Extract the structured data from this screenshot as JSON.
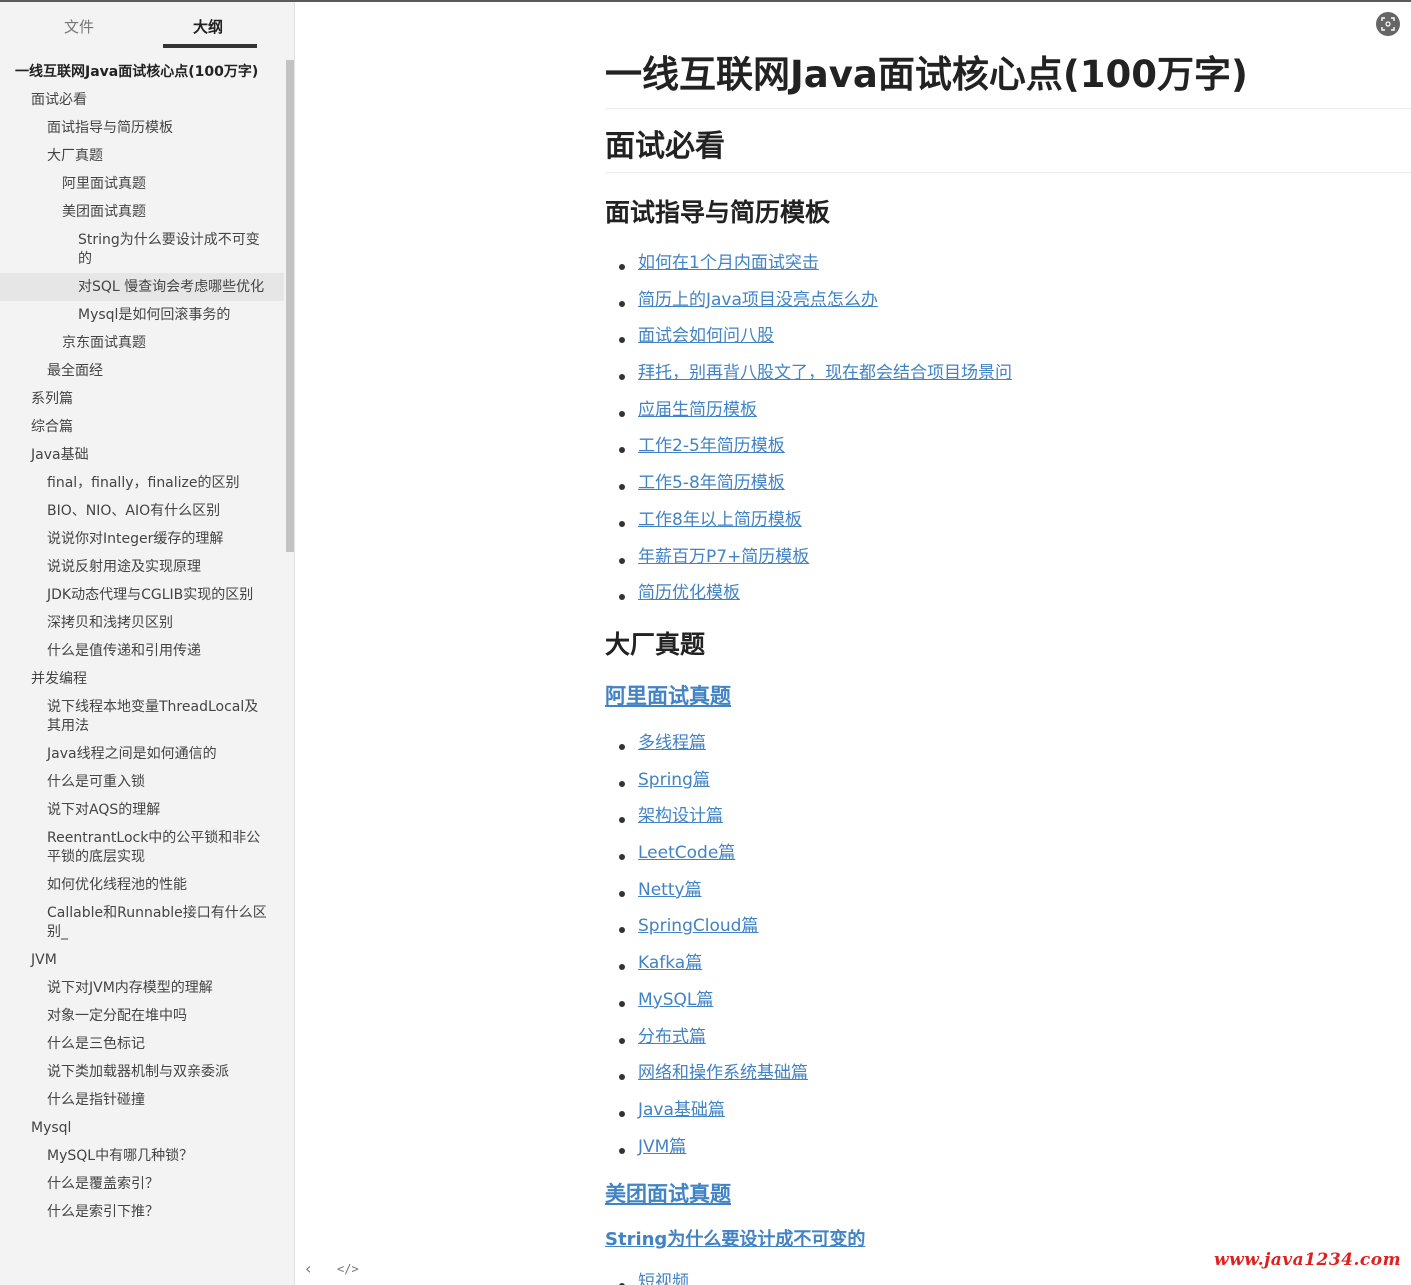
{
  "sidebar": {
    "tabs": {
      "files": "文件",
      "outline": "大纲"
    },
    "outline": [
      {
        "label": "一线互联网Java面试核心点(100万字)",
        "level": 0
      },
      {
        "label": "面试必看",
        "level": 1
      },
      {
        "label": "面试指导与简历模板",
        "level": 2
      },
      {
        "label": "大厂真题",
        "level": 2
      },
      {
        "label": "阿里面试真题",
        "level": 3
      },
      {
        "label": "美团面试真题",
        "level": 3
      },
      {
        "label": "String为什么要设计成不可变的",
        "level": 4
      },
      {
        "label": "对SQL 慢查询会考虑哪些优化",
        "level": 4,
        "active": true
      },
      {
        "label": "Mysql是如何回滚事务的",
        "level": 4
      },
      {
        "label": "京东面试真题",
        "level": 3
      },
      {
        "label": "最全面经",
        "level": 2
      },
      {
        "label": "系列篇",
        "level": 1
      },
      {
        "label": "综合篇",
        "level": 1
      },
      {
        "label": "Java基础",
        "level": 1
      },
      {
        "label": "final，finally，finalize的区别",
        "level": 2
      },
      {
        "label": "BIO、NIO、AIO有什么区别",
        "level": 2
      },
      {
        "label": "说说你对Integer缓存的理解",
        "level": 2
      },
      {
        "label": "说说反射用途及实现原理",
        "level": 2
      },
      {
        "label": "JDK动态代理与CGLIB实现的区别",
        "level": 2
      },
      {
        "label": "深拷贝和浅拷贝区别",
        "level": 2
      },
      {
        "label": "什么是值传递和引用传递",
        "level": 2
      },
      {
        "label": "并发编程",
        "level": 1
      },
      {
        "label": "说下线程本地变量ThreadLocal及其用法",
        "level": 2
      },
      {
        "label": "Java线程之间是如何通信的",
        "level": 2
      },
      {
        "label": "什么是可重入锁",
        "level": 2
      },
      {
        "label": "说下对AQS的理解",
        "level": 2
      },
      {
        "label": "ReentrantLock中的公平锁和非公平锁的底层实现",
        "level": 2
      },
      {
        "label": "如何优化线程池的性能",
        "level": 2
      },
      {
        "label": "Callable和Runnable接口有什么区别_",
        "level": 2
      },
      {
        "label": "JVM",
        "level": 1
      },
      {
        "label": "说下对JVM内存模型的理解",
        "level": 2
      },
      {
        "label": "对象一定分配在堆中吗",
        "level": 2
      },
      {
        "label": "什么是三色标记",
        "level": 2
      },
      {
        "label": "说下类加载器机制与双亲委派",
        "level": 2
      },
      {
        "label": "什么是指针碰撞",
        "level": 2
      },
      {
        "label": "Mysql",
        "level": 1
      },
      {
        "label": "MySQL中有哪几种锁？",
        "level": 2
      },
      {
        "label": "什么是覆盖索引？",
        "level": 2
      },
      {
        "label": "什么是索引下推？",
        "level": 2
      }
    ]
  },
  "controls": {
    "prev": "‹",
    "code": "</>"
  },
  "content": {
    "h1": "一线互联网Java面试核心点(100万字)",
    "h2_must_read": "面试必看",
    "h3_guide": "面试指导与简历模板",
    "guide_links": [
      "如何在1个月内面试突击",
      "简历上的Java项目没亮点怎么办",
      "面试会如何问八股",
      "拜托，别再背八股文了，现在都会结合项目场景问",
      "应届生简历模板",
      "工作2-5年简历模板",
      "工作5-8年简历模板",
      "工作8年以上简历模板",
      "年薪百万P7+简历模板",
      "简历优化模板"
    ],
    "h3_bigco": "大厂真题",
    "h4_ali": "阿里面试真题",
    "ali_links": [
      "多线程篇",
      "Spring篇",
      "架构设计篇",
      "LeetCode篇",
      "Netty篇",
      "SpringCloud篇",
      "Kafka篇",
      "MySQL篇",
      "分布式篇",
      "网络和操作系统基础篇",
      "Java基础篇",
      "JVM篇"
    ],
    "h4_meituan": "美团面试真题",
    "h5_string": "String为什么要设计成不可变的",
    "partial_link": "短视频"
  },
  "watermark": "www.java1234.com"
}
